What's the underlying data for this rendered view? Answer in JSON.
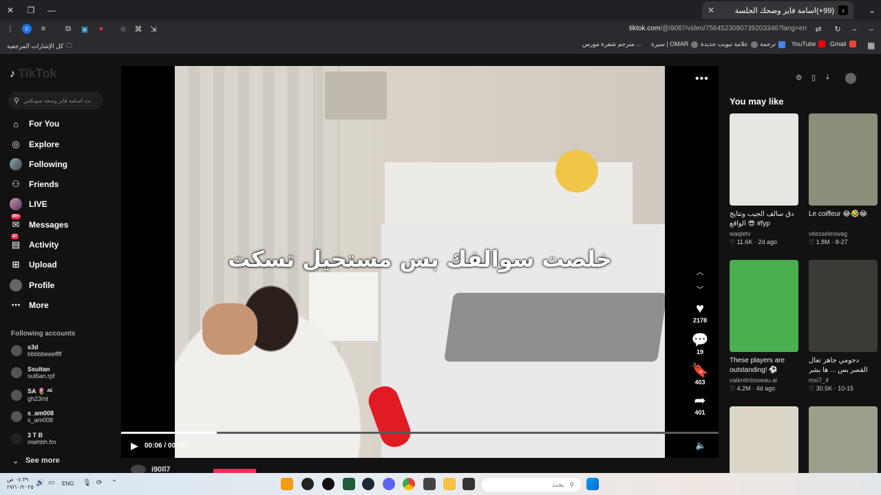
{
  "browser": {
    "tab_title": "(99+)اسامة فايز وضحك الجلسة",
    "new_tab_label": "+",
    "url_domain": "tiktok.com",
    "url_path": "/@i90ll7/video/7564523090739203346?lang=en",
    "bookmarks_folder": "كل الإشارات المرجعية",
    "bookmarks": [
      "Gmail",
      "YouTube",
      "ترجمة",
      "علامة تبويب جديدة",
      "سيرة | OMAR",
      "مترجم شفرة مورس ..."
    ]
  },
  "sidebar": {
    "logo": "TikTok",
    "search_placeholder": "بث اسامه فايز وسعد سونكس",
    "nav": [
      {
        "label": "For You"
      },
      {
        "label": "Explore"
      },
      {
        "label": "Following"
      },
      {
        "label": "Friends"
      },
      {
        "label": "LIVE"
      },
      {
        "label": "Messages",
        "badge": "99+"
      },
      {
        "label": "Activity",
        "badge": "37"
      },
      {
        "label": "Upload"
      },
      {
        "label": "Profile"
      },
      {
        "label": "More"
      }
    ],
    "following_header": "Following accounts",
    "accounts": [
      {
        "name": "s3d",
        "handle": "bbbbbeeeffff"
      },
      {
        "name": "Ssultan",
        "handle": "sul6an.rpf"
      },
      {
        "name": "SA 🌷 ᴬᴱ",
        "handle": "gh23mt"
      },
      {
        "name": "s_am008",
        "handle": "s_am008"
      },
      {
        "name": "3 T B",
        "handle": "mwhbh.fm"
      }
    ],
    "see_more": "See more"
  },
  "video": {
    "caption": "خلصت سوالفك بس مستحيل تسكت",
    "time": "00:06 / 00:41",
    "progress": 0.16,
    "creator": "i90ll7",
    "likes": "2178",
    "comments": "19",
    "saves": "403",
    "shares": "401"
  },
  "recommendations": {
    "header": "You may like",
    "cards": [
      {
        "title": "دق سالف الجيب ونتايج الواقع 😎 #fyp #explore...",
        "user": "waqietv",
        "views": "11.6K",
        "age": "2d ago",
        "color": "#e8e6e2"
      },
      {
        "title": "Le coiffeur 😂🤣😂",
        "user": "vitesseleswag",
        "views": "1.8M",
        "age": "8-27",
        "color": "#8a8f7a"
      },
      {
        "title": "These players are outstanding! ⚽",
        "user": "valentinloiseau.ai",
        "views": "4.2M",
        "age": "4d ago",
        "color": "#4caf50"
      },
      {
        "title": "دحومي جاهز تعال القصر بس ... ها بشر رجعت جده ولا؟؟",
        "user": "mxi7_4",
        "views": "30.5K",
        "age": "10-15",
        "color": "#3b3a36"
      },
      {
        "title": "",
        "user": "",
        "views": "",
        "age": "",
        "color": "#dcd6c8"
      },
      {
        "title": "",
        "user": "",
        "views": "",
        "age": "",
        "color": "#9aa08c"
      }
    ]
  },
  "taskbar": {
    "search_placeholder": "بحث",
    "lang": "ENG",
    "clock_time": "٠٤:٣٩ ص",
    "clock_date": "٢٧/١٠/٢٠٢٥"
  }
}
